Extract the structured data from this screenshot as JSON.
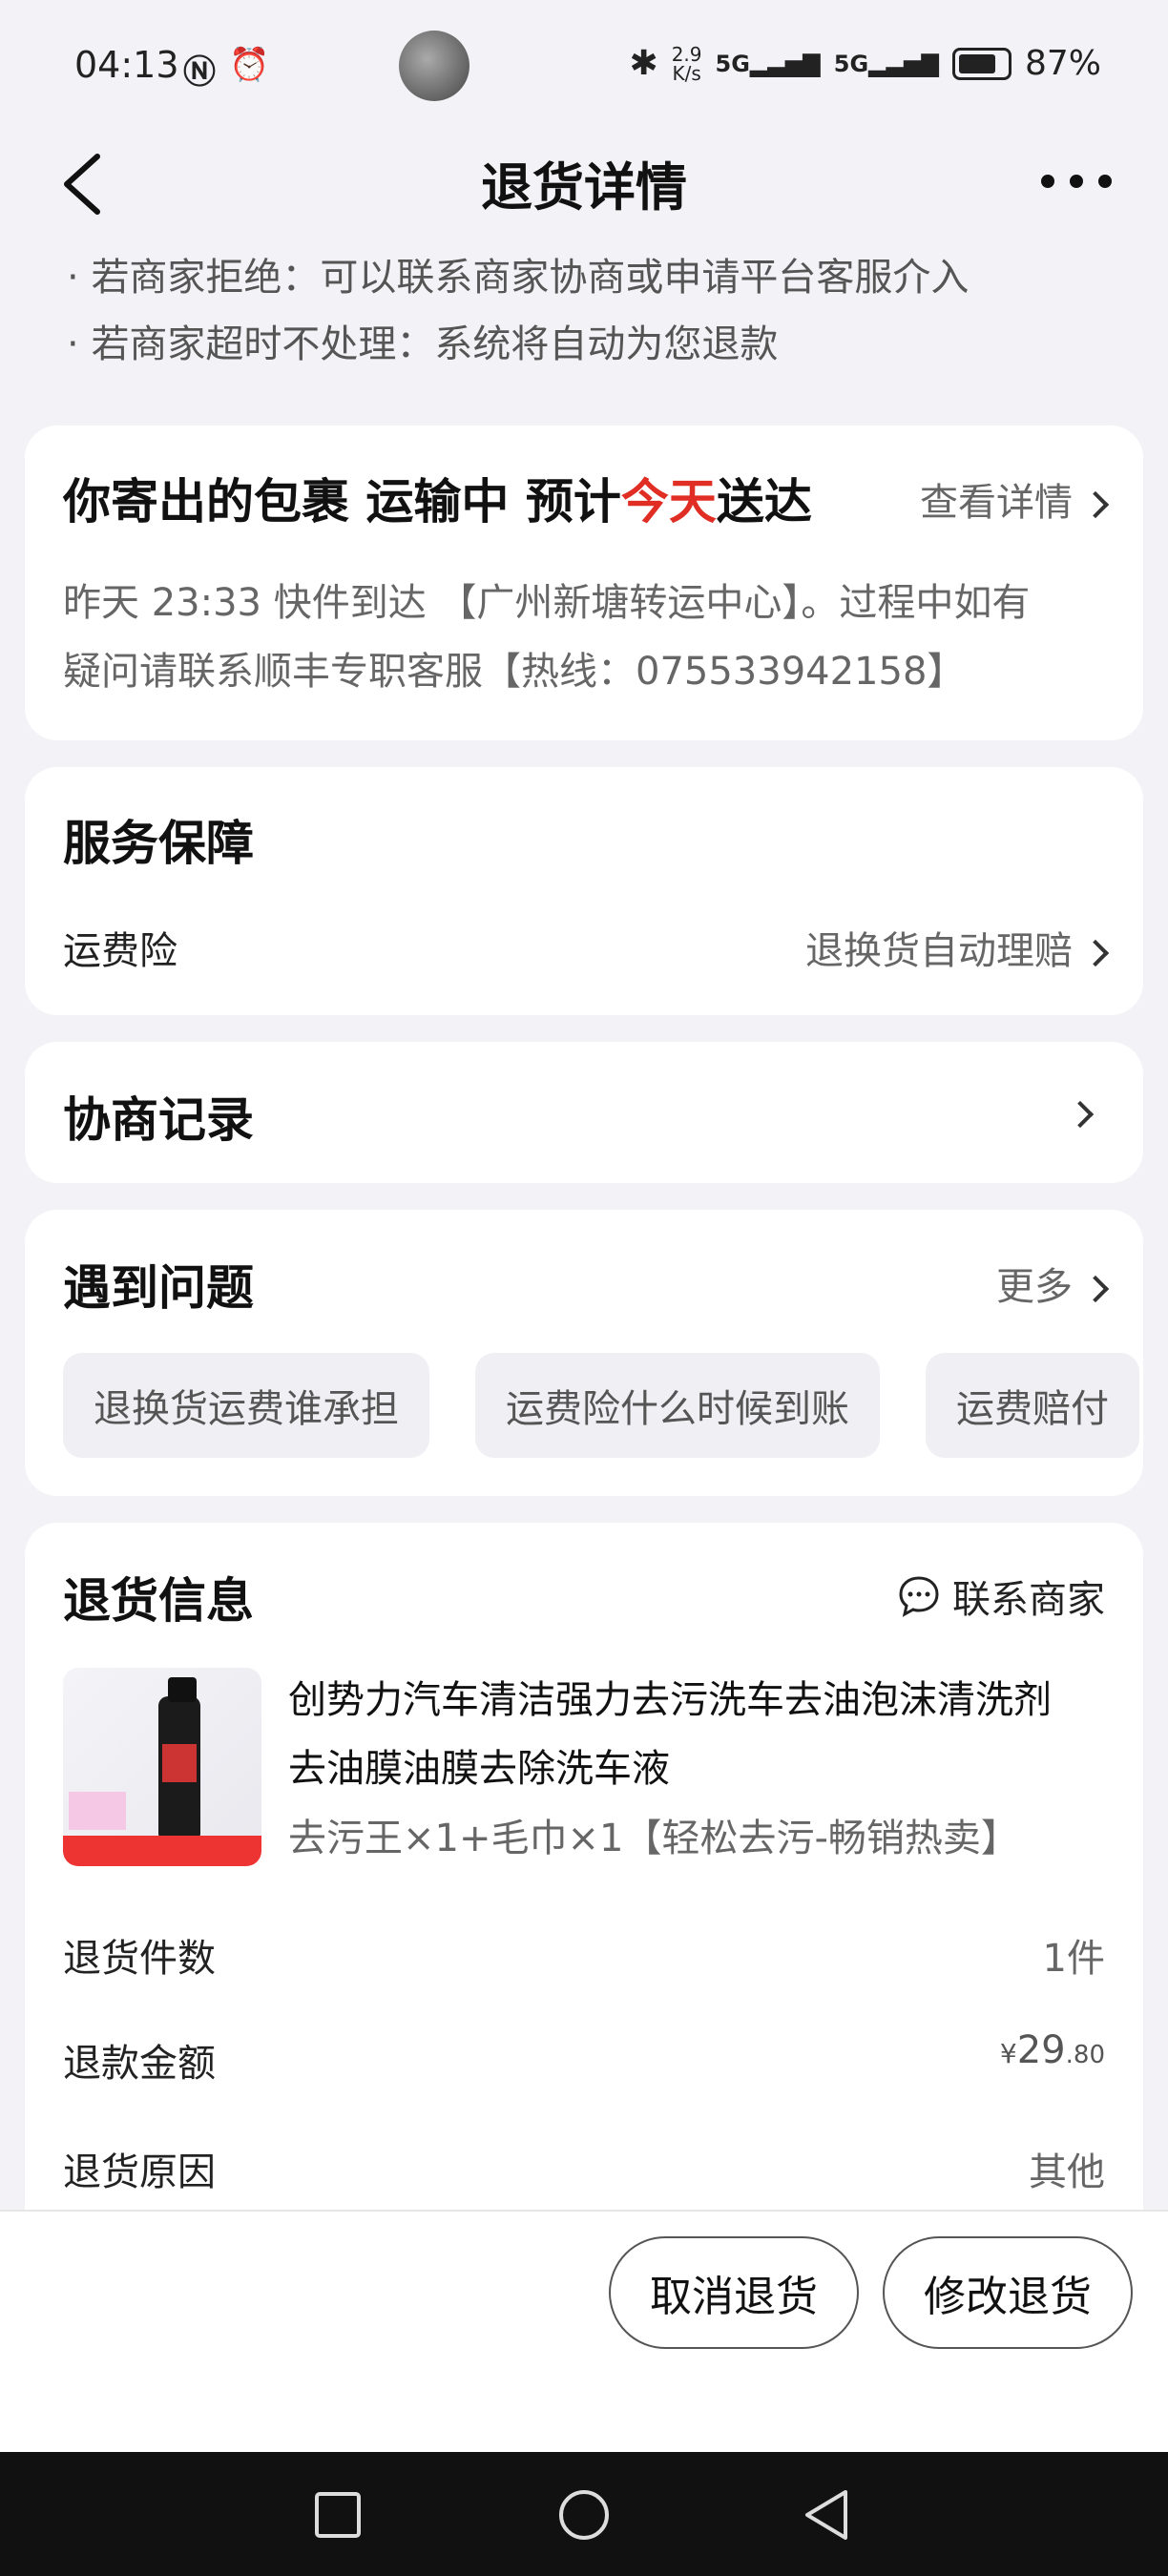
{
  "status": {
    "time": "04:13",
    "net_speed_top": "2.9",
    "net_speed_bottom": "K/s",
    "net1": "5G",
    "net2": "5G",
    "battery": "87%"
  },
  "header": {
    "title": "退货详情"
  },
  "notes": [
    "若商家拒绝：可以联系商家协商或申请平台客服介入",
    "若商家超时不处理：系统将自动为您退款"
  ],
  "logistics": {
    "title_pre": "你寄出的包裹 运输中 预计",
    "title_highlight": "今天",
    "title_post": "送达",
    "link": "查看详情",
    "detail_line1": "昨天 23:33  快件到达 【广州新塘转运中心】。过程中如有",
    "detail_line2": "疑问请联系顺丰专职客服【热线：075533942158】",
    "highlight_color": "#e02e24"
  },
  "service": {
    "title": "服务保障",
    "row_label": "运费险",
    "row_value": "退换货自动理赔"
  },
  "negotiation": {
    "title": "协商记录"
  },
  "problems": {
    "title": "遇到问题",
    "more": "更多",
    "chips": [
      "退换货运费谁承担",
      "运费险什么时候到账",
      "运费赔付"
    ]
  },
  "return_info": {
    "title": "退货信息",
    "contact": "联系商家",
    "product_title_line1": "创势力汽车清洁强力去污洗车去油泡沫清洗剂",
    "product_title_line2": "去油膜油膜去除洗车液",
    "product_spec": "去污王×1+毛巾×1【轻松去污-畅销热卖】",
    "rows": [
      {
        "label": "退货件数",
        "value": "1件"
      },
      {
        "label": "退款金额",
        "value_symbol": "¥",
        "value_int": "29",
        "value_dec": ".80"
      },
      {
        "label": "退货原因",
        "value": "其他"
      }
    ]
  },
  "actions": {
    "cancel": "取消退货",
    "modify": "修改退货"
  }
}
